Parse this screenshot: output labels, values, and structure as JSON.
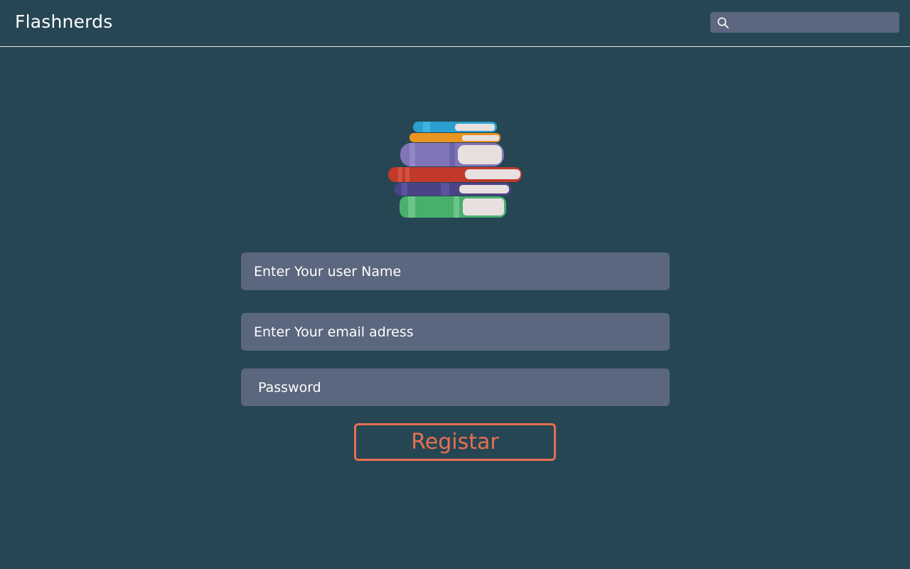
{
  "header": {
    "brand": "Flashnerds",
    "search": {
      "icon": "search-icon",
      "placeholder": "",
      "value": ""
    }
  },
  "hero": {
    "icon": "books-stack-icon"
  },
  "form": {
    "username_placeholder": "Enter Your user Name",
    "email_placeholder": "Enter Your email adress",
    "password_placeholder": "Password",
    "submit_label": "Registar"
  },
  "colors": {
    "background": "#264653",
    "field": "#5a677e",
    "accent": "#e76f51",
    "text": "#ffffff"
  }
}
